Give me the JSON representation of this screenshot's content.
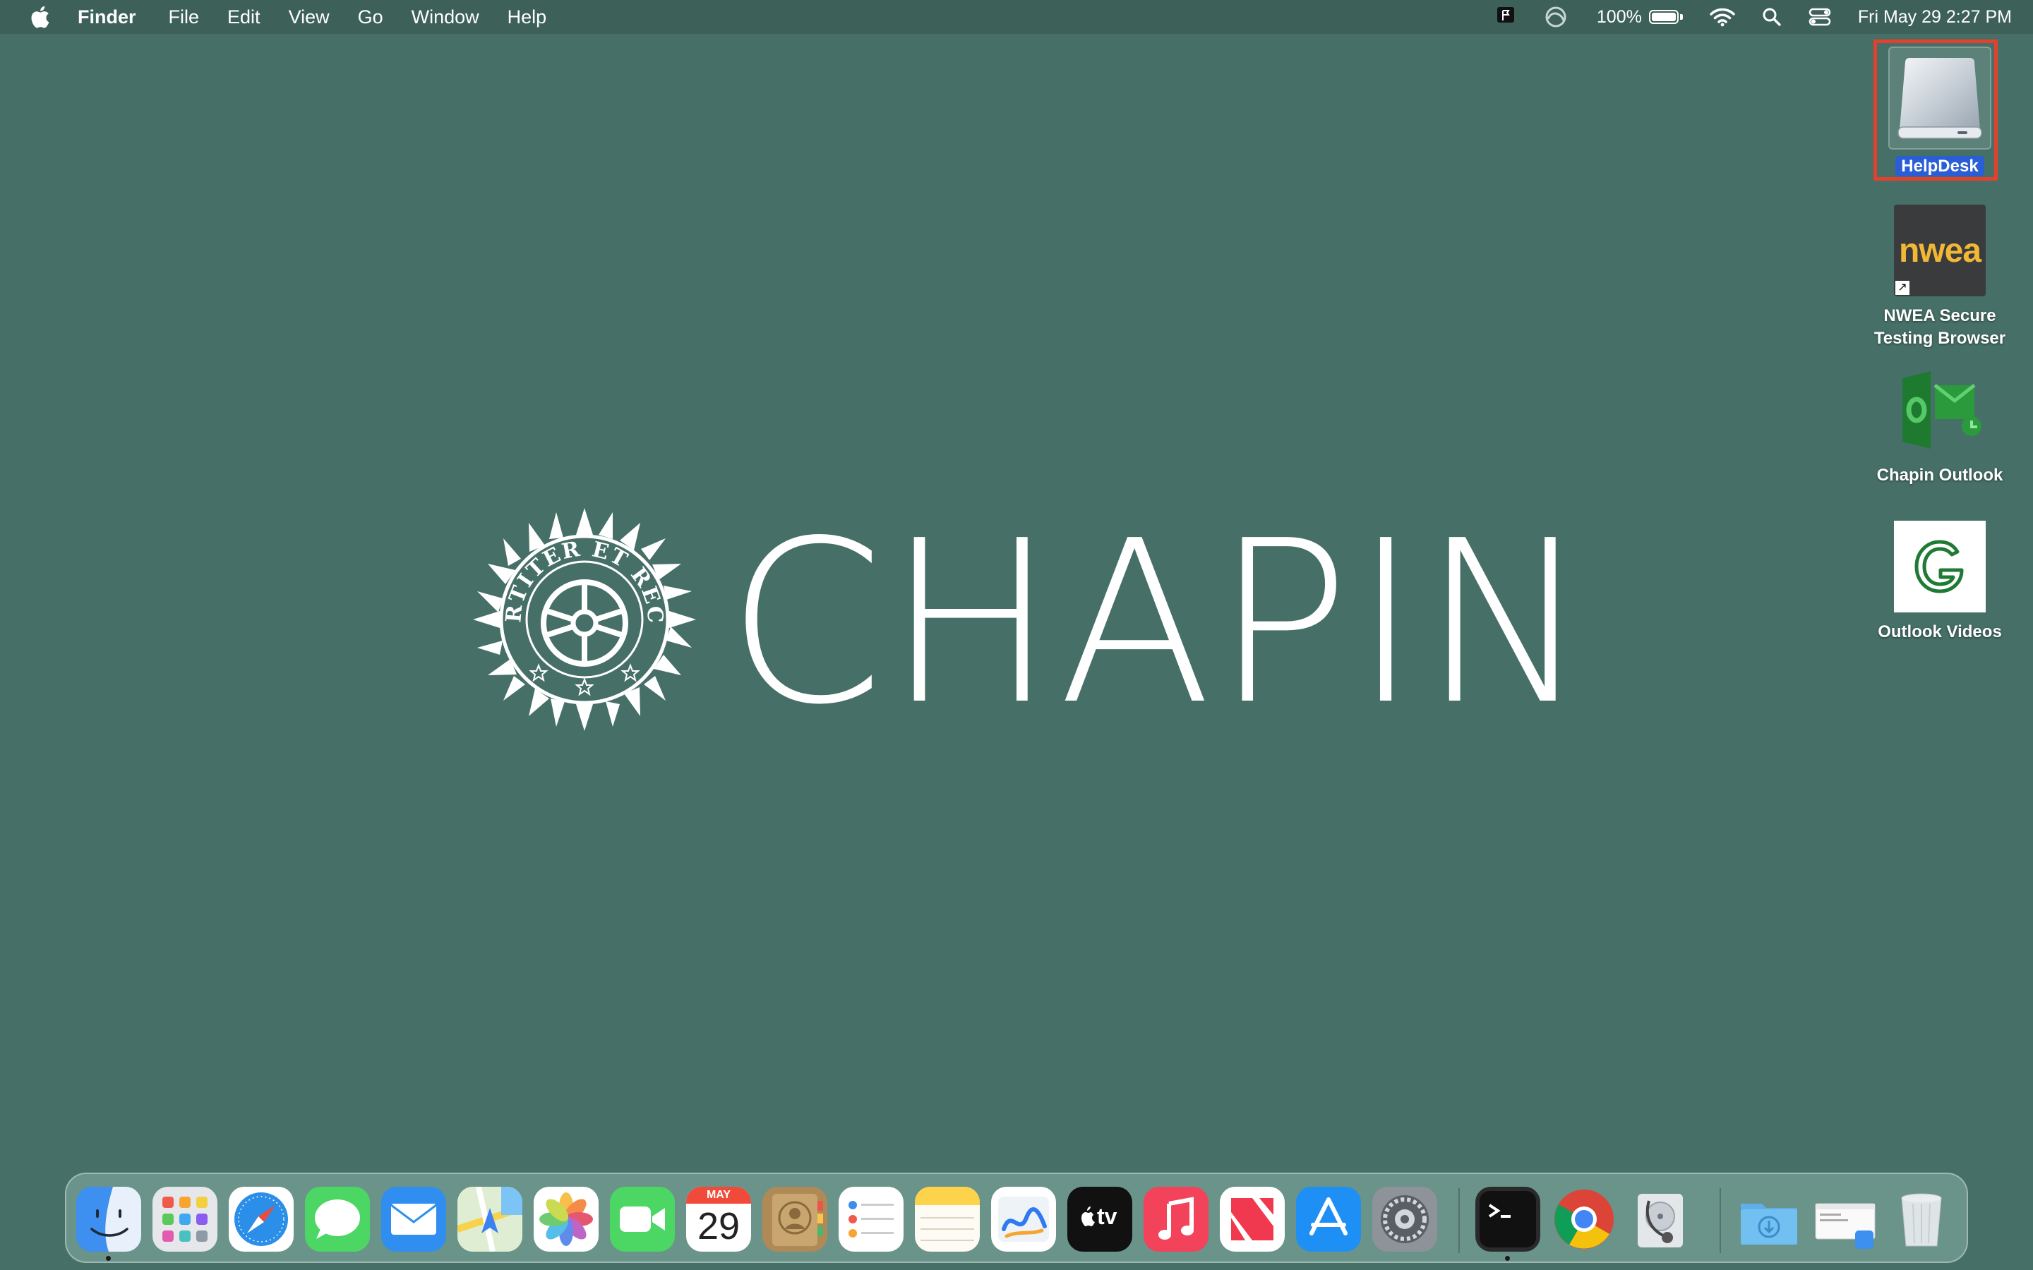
{
  "menubar": {
    "app_name": "Finder",
    "menus": [
      "File",
      "Edit",
      "View",
      "Go",
      "Window",
      "Help"
    ],
    "battery_percent": "100%",
    "battery_level": 1.0,
    "datetime": "Fri May 29  2:27 PM"
  },
  "wallpaper": {
    "wordmark": "CHAPIN",
    "seal_motto": "FORTITER ET RECTE"
  },
  "desktop_icons": [
    {
      "label": "HelpDesk",
      "icon": "external-drive-icon",
      "selected": true
    },
    {
      "label": "NWEA Secure Testing Browser",
      "icon": "nwea-icon",
      "icon_text": "nwea"
    },
    {
      "label": "Chapin Outlook",
      "icon": "outlook-icon"
    },
    {
      "label": "Outlook Videos",
      "icon": "g-icon"
    }
  ],
  "dock": {
    "apps": [
      "Finder",
      "Launchpad",
      "Safari",
      "Messages",
      "Mail",
      "Maps",
      "Photos",
      "FaceTime",
      "Calendar",
      "Contacts",
      "Reminders",
      "Notes",
      "Freeform",
      "TV",
      "Music",
      "News",
      "App Store",
      "System Settings",
      "Terminal",
      "Google Chrome",
      "Disk Utility",
      "Downloads",
      "Window",
      "Trash"
    ],
    "calendar": {
      "month": "MAY",
      "day": "29"
    },
    "tv_label": "tv"
  },
  "colors": {
    "desktop": "#467067",
    "menubar": "#3d6158",
    "selection_outline": "#e3402e",
    "selection_label": "#2a5ed6"
  }
}
